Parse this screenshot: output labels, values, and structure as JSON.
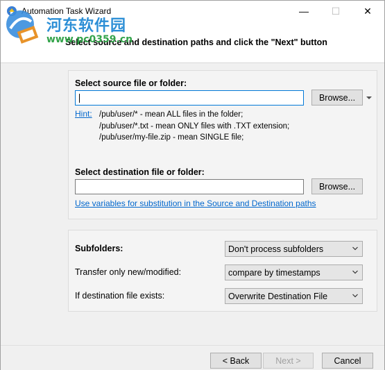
{
  "window": {
    "title": "Automation Task Wizard",
    "minimize_symbol": "—",
    "maximize_symbol": "☐",
    "close_symbol": "✕"
  },
  "watermark": {
    "cn_text": "河东软件园",
    "url": "www.pc0359.cn"
  },
  "header": {
    "instruction": "Select source and destination paths and click the \"Next\" button"
  },
  "source": {
    "label": "Select source file or folder:",
    "value": "",
    "browse_label": "Browse...",
    "hint_link": "Hint:",
    "hint_lines": [
      "/pub/user/* - mean ALL files in the folder;",
      "/pub/user/*.txt - mean ONLY files with .TXT extension;",
      "/pub/user/my-file.zip - mean SINGLE file;"
    ]
  },
  "destination": {
    "label": "Select destination file or folder:",
    "value": "",
    "browse_label": "Browse...",
    "variables_link": "Use variables for substitution in the Source and Destination paths"
  },
  "options": {
    "subfolders_label": "Subfolders:",
    "subfolders_value": "Don't process subfolders",
    "transfer_label": "Transfer only new/modified:",
    "transfer_value": "compare by timestamps",
    "exists_label": "If destination file exists:",
    "exists_value": "Overwrite Destination File"
  },
  "footer": {
    "back_label": "< Back",
    "next_label": "Next >",
    "cancel_label": "Cancel"
  },
  "icons": {
    "app": "wizard-app-icon",
    "dropdown": "chevron-down-icon",
    "browse_menu": "caret-down-icon"
  }
}
